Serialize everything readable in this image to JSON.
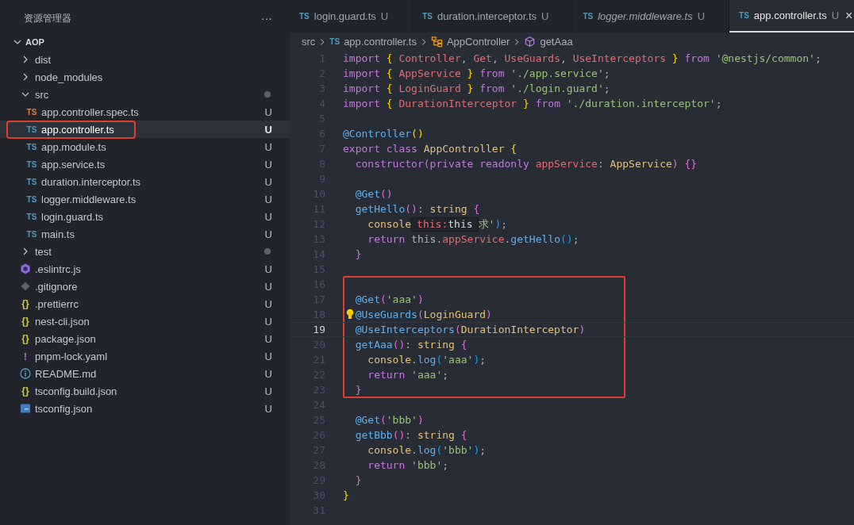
{
  "explorer": {
    "title": "资源管理器",
    "more": "···",
    "root": {
      "label": "AOP",
      "expanded": true
    },
    "items": [
      {
        "kind": "folder",
        "label": "dist",
        "expanded": false,
        "dot": false,
        "selected": false,
        "boxed": false
      },
      {
        "kind": "folder",
        "label": "node_modules",
        "expanded": false,
        "dot": false,
        "selected": false,
        "boxed": false
      },
      {
        "kind": "folder",
        "label": "src",
        "expanded": true,
        "dot": true,
        "selected": false,
        "boxed": false,
        "children": [
          {
            "kind": "ts-test",
            "icon_text": "TS",
            "label": "app.controller.spec.ts",
            "badge": "U",
            "selected": false,
            "boxed": false
          },
          {
            "kind": "ts",
            "icon_text": "TS",
            "label": "app.controller.ts",
            "badge": "U",
            "selected": true,
            "boxed": true
          },
          {
            "kind": "ts",
            "icon_text": "TS",
            "label": "app.module.ts",
            "badge": "U",
            "selected": false,
            "boxed": false
          },
          {
            "kind": "ts",
            "icon_text": "TS",
            "label": "app.service.ts",
            "badge": "U",
            "selected": false,
            "boxed": false
          },
          {
            "kind": "ts",
            "icon_text": "TS",
            "label": "duration.interceptor.ts",
            "badge": "U",
            "selected": false,
            "boxed": false
          },
          {
            "kind": "ts",
            "icon_text": "TS",
            "label": "logger.middleware.ts",
            "badge": "U",
            "selected": false,
            "boxed": false
          },
          {
            "kind": "ts",
            "icon_text": "TS",
            "label": "login.guard.ts",
            "badge": "U",
            "selected": false,
            "boxed": false
          },
          {
            "kind": "ts",
            "icon_text": "TS",
            "label": "main.ts",
            "badge": "U",
            "selected": false,
            "boxed": false
          }
        ]
      },
      {
        "kind": "folder",
        "label": "test",
        "expanded": false,
        "dot": true,
        "selected": false,
        "boxed": false
      },
      {
        "kind": "eslint",
        "label": ".eslintrc.js",
        "badge": "U",
        "selected": false,
        "boxed": false
      },
      {
        "kind": "git",
        "label": ".gitignore",
        "badge": "U",
        "selected": false,
        "boxed": false
      },
      {
        "kind": "json",
        "icon_text": "{}",
        "label": ".prettierrc",
        "badge": "U",
        "selected": false,
        "boxed": false
      },
      {
        "kind": "json",
        "icon_text": "{}",
        "label": "nest-cli.json",
        "badge": "U",
        "selected": false,
        "boxed": false
      },
      {
        "kind": "json",
        "icon_text": "{}",
        "label": "package.json",
        "badge": "U",
        "selected": false,
        "boxed": false
      },
      {
        "kind": "yaml",
        "icon_text": "!",
        "label": "pnpm-lock.yaml",
        "badge": "U",
        "selected": false,
        "boxed": false
      },
      {
        "kind": "info",
        "label": "README.md",
        "badge": "U",
        "selected": false,
        "boxed": false
      },
      {
        "kind": "json",
        "icon_text": "{}",
        "label": "tsconfig.build.json",
        "badge": "U",
        "selected": false,
        "boxed": false
      },
      {
        "kind": "tsconfig",
        "label": "tsconfig.json",
        "badge": "U",
        "selected": false,
        "boxed": false
      }
    ]
  },
  "tabs": [
    {
      "icon_text": "TS",
      "label": "login.guard.ts",
      "badge": "U",
      "selected": false,
      "preview": false
    },
    {
      "icon_text": "TS",
      "label": "duration.interceptor.ts",
      "badge": "U",
      "selected": false,
      "preview": false
    },
    {
      "icon_text": "TS",
      "label": "logger.middleware.ts",
      "badge": "U",
      "selected": false,
      "preview": true
    },
    {
      "icon_text": "TS",
      "label": "app.controller.ts",
      "badge": "U",
      "selected": true,
      "preview": false,
      "close": "×"
    }
  ],
  "breadcrumb": [
    {
      "kind": "folder",
      "label": "src"
    },
    {
      "kind": "ts",
      "icon_text": "TS",
      "label": "app.controller.ts"
    },
    {
      "kind": "class",
      "label": "AppController"
    },
    {
      "kind": "method",
      "label": "getAaa"
    }
  ],
  "code": {
    "sections": [
      {
        "boxed": false,
        "lines": [
          {
            "number": "1",
            "current": false,
            "hint": false,
            "tokens": [
              {
                "kind": "keyword",
                "text": "import "
              },
              {
                "kind": "bracket1",
                "text": "{ "
              },
              {
                "kind": "variable",
                "text": "Controller"
              },
              {
                "kind": "plain",
                "text": ", "
              },
              {
                "kind": "variable",
                "text": "Get"
              },
              {
                "kind": "plain",
                "text": ", "
              },
              {
                "kind": "variable",
                "text": "UseGuards"
              },
              {
                "kind": "plain",
                "text": ", "
              },
              {
                "kind": "variable",
                "text": "UseInterceptors"
              },
              {
                "kind": "bracket1",
                "text": " }"
              },
              {
                "kind": "keyword",
                "text": " from "
              },
              {
                "kind": "string",
                "text": "'@nestjs/common'"
              },
              {
                "kind": "plain",
                "text": ";"
              }
            ]
          },
          {
            "number": "2",
            "current": false,
            "hint": false,
            "tokens": [
              {
                "kind": "keyword",
                "text": "import "
              },
              {
                "kind": "bracket1",
                "text": "{ "
              },
              {
                "kind": "variable",
                "text": "AppService"
              },
              {
                "kind": "bracket1",
                "text": " }"
              },
              {
                "kind": "keyword",
                "text": " from "
              },
              {
                "kind": "string",
                "text": "'./app.service'"
              },
              {
                "kind": "plain",
                "text": ";"
              }
            ]
          },
          {
            "number": "3",
            "current": false,
            "hint": false,
            "tokens": [
              {
                "kind": "keyword",
                "text": "import "
              },
              {
                "kind": "bracket1",
                "text": "{ "
              },
              {
                "kind": "variable",
                "text": "LoginGuard"
              },
              {
                "kind": "bracket1",
                "text": " }"
              },
              {
                "kind": "keyword",
                "text": " from "
              },
              {
                "kind": "string",
                "text": "'./login.guard'"
              },
              {
                "kind": "plain",
                "text": ";"
              }
            ]
          },
          {
            "number": "4",
            "current": false,
            "hint": false,
            "tokens": [
              {
                "kind": "keyword",
                "text": "import "
              },
              {
                "kind": "bracket1",
                "text": "{ "
              },
              {
                "kind": "variable",
                "text": "DurationInterceptor"
              },
              {
                "kind": "bracket1",
                "text": " }"
              },
              {
                "kind": "keyword",
                "text": " from "
              },
              {
                "kind": "string",
                "text": "'./duration.interceptor'"
              },
              {
                "kind": "plain",
                "text": ";"
              }
            ]
          },
          {
            "number": "5",
            "current": false,
            "hint": false
          },
          {
            "number": "6",
            "current": false,
            "hint": false,
            "tokens": [
              {
                "kind": "function",
                "text": "@Controller"
              },
              {
                "kind": "bracket1",
                "text": "()"
              }
            ]
          },
          {
            "number": "7",
            "current": false,
            "hint": false,
            "tokens": [
              {
                "kind": "keyword",
                "text": "export class "
              },
              {
                "kind": "type",
                "text": "AppController "
              },
              {
                "kind": "bracket1",
                "text": "{"
              }
            ]
          },
          {
            "number": "8",
            "current": false,
            "hint": false,
            "tokens": [
              {
                "kind": "keyword",
                "text": "  constructor"
              },
              {
                "kind": "bracket2",
                "text": "("
              },
              {
                "kind": "keyword",
                "text": "private readonly "
              },
              {
                "kind": "variable",
                "text": "appService"
              },
              {
                "kind": "plain",
                "text": ": "
              },
              {
                "kind": "type",
                "text": "AppService"
              },
              {
                "kind": "bracket2",
                "text": ") {}"
              }
            ]
          },
          {
            "number": "9",
            "current": false,
            "hint": false
          },
          {
            "number": "10",
            "current": false,
            "hint": false,
            "tokens": [
              {
                "kind": "function",
                "text": "  @Get"
              },
              {
                "kind": "bracket2",
                "text": "()"
              }
            ]
          },
          {
            "number": "11",
            "current": false,
            "hint": false,
            "tokens": [
              {
                "kind": "function",
                "text": "  getHello"
              },
              {
                "kind": "bracket2",
                "text": "()"
              },
              {
                "kind": "plain",
                "text": ": "
              },
              {
                "kind": "type",
                "text": "string "
              },
              {
                "kind": "bracket2",
                "text": "{"
              }
            ]
          },
          {
            "number": "12",
            "current": false,
            "hint": false,
            "tokens": [
              {
                "kind": "type",
                "text": "    console"
              }
            ],
            "tooltip": {
              "label": "this:",
              "value": "this"
            },
            "after": [
              {
                "kind": "string",
                "text": "求'"
              },
              {
                "kind": "bracket3",
                "text": ")"
              },
              {
                "kind": "plain",
                "text": ";"
              }
            ]
          },
          {
            "number": "13",
            "current": false,
            "hint": false,
            "tokens": [
              {
                "kind": "keyword",
                "text": "    return "
              },
              {
                "kind": "plain",
                "text": "this."
              },
              {
                "kind": "variable",
                "text": "appService"
              },
              {
                "kind": "plain",
                "text": "."
              },
              {
                "kind": "function",
                "text": "getHello"
              },
              {
                "kind": "bracket3",
                "text": "()"
              },
              {
                "kind": "plain",
                "text": ";"
              }
            ]
          },
          {
            "number": "14",
            "current": false,
            "hint": false,
            "tokens": [
              {
                "kind": "bracket2",
                "text": "  }"
              }
            ]
          },
          {
            "number": "15",
            "current": false,
            "hint": false
          }
        ]
      },
      {
        "boxed": true,
        "lines": [
          {
            "number": "16",
            "current": false,
            "hint": false
          },
          {
            "number": "17",
            "current": false,
            "hint": false,
            "tokens": [
              {
                "kind": "function",
                "text": "  @Get"
              },
              {
                "kind": "bracket2",
                "text": "("
              },
              {
                "kind": "string",
                "text": "'aaa'"
              },
              {
                "kind": "bracket2",
                "text": ")"
              }
            ]
          },
          {
            "number": "18",
            "current": false,
            "hint": true,
            "tokens": [
              {
                "kind": "function",
                "text": "  @UseGuards"
              },
              {
                "kind": "bracket2",
                "text": "("
              },
              {
                "kind": "type",
                "text": "LoginGuard"
              },
              {
                "kind": "bracket2",
                "text": ")"
              }
            ]
          },
          {
            "number": "19",
            "current": true,
            "hint": false,
            "tokens": [
              {
                "kind": "function",
                "text": "  @UseInterceptors"
              },
              {
                "kind": "bracket2",
                "text": "("
              },
              {
                "kind": "type",
                "text": "DurationInterceptor"
              },
              {
                "kind": "bracket2",
                "text": ")"
              }
            ]
          },
          {
            "number": "20",
            "current": false,
            "hint": false,
            "tokens": [
              {
                "kind": "function",
                "text": "  getAaa"
              },
              {
                "kind": "bracket2",
                "text": "()"
              },
              {
                "kind": "plain",
                "text": ": "
              },
              {
                "kind": "type",
                "text": "string "
              },
              {
                "kind": "bracket2",
                "text": "{"
              }
            ]
          },
          {
            "number": "21",
            "current": false,
            "hint": false,
            "tokens": [
              {
                "kind": "type",
                "text": "    console"
              },
              {
                "kind": "plain",
                "text": "."
              },
              {
                "kind": "function",
                "text": "log"
              },
              {
                "kind": "bracket3",
                "text": "("
              },
              {
                "kind": "string",
                "text": "'aaa'"
              },
              {
                "kind": "bracket3",
                "text": ")"
              },
              {
                "kind": "plain",
                "text": ";"
              }
            ]
          },
          {
            "number": "22",
            "current": false,
            "hint": false,
            "tokens": [
              {
                "kind": "keyword",
                "text": "    return "
              },
              {
                "kind": "string",
                "text": "'aaa'"
              },
              {
                "kind": "plain",
                "text": ";"
              }
            ]
          },
          {
            "number": "23",
            "current": false,
            "hint": false,
            "tokens": [
              {
                "kind": "bracket2",
                "text": "  }"
              }
            ]
          }
        ]
      },
      {
        "boxed": false,
        "lines": [
          {
            "number": "24",
            "current": false,
            "hint": false
          },
          {
            "number": "25",
            "current": false,
            "hint": false,
            "tokens": [
              {
                "kind": "function",
                "text": "  @Get"
              },
              {
                "kind": "bracket2",
                "text": "("
              },
              {
                "kind": "string",
                "text": "'bbb'"
              },
              {
                "kind": "bracket2",
                "text": ")"
              }
            ]
          },
          {
            "number": "26",
            "current": false,
            "hint": false,
            "tokens": [
              {
                "kind": "function",
                "text": "  getBbb"
              },
              {
                "kind": "bracket2",
                "text": "()"
              },
              {
                "kind": "plain",
                "text": ": "
              },
              {
                "kind": "type",
                "text": "string "
              },
              {
                "kind": "bracket2",
                "text": "{"
              }
            ]
          },
          {
            "number": "27",
            "current": false,
            "hint": false,
            "tokens": [
              {
                "kind": "type",
                "text": "    console"
              },
              {
                "kind": "plain",
                "text": "."
              },
              {
                "kind": "function",
                "text": "log"
              },
              {
                "kind": "bracket3",
                "text": "("
              },
              {
                "kind": "string",
                "text": "'bbb'"
              },
              {
                "kind": "bracket3",
                "text": ")"
              },
              {
                "kind": "plain",
                "text": ";"
              }
            ]
          },
          {
            "number": "28",
            "current": false,
            "hint": false,
            "tokens": [
              {
                "kind": "keyword",
                "text": "    return "
              },
              {
                "kind": "string",
                "text": "'bbb'"
              },
              {
                "kind": "plain",
                "text": ";"
              }
            ]
          },
          {
            "number": "29",
            "current": false,
            "hint": false,
            "tokens": [
              {
                "kind": "bracket2",
                "text": "  }"
              }
            ]
          },
          {
            "number": "30",
            "current": false,
            "hint": false,
            "tokens": [
              {
                "kind": "bracket1",
                "text": "}"
              }
            ]
          },
          {
            "number": "31",
            "current": false,
            "hint": false
          }
        ]
      }
    ]
  }
}
